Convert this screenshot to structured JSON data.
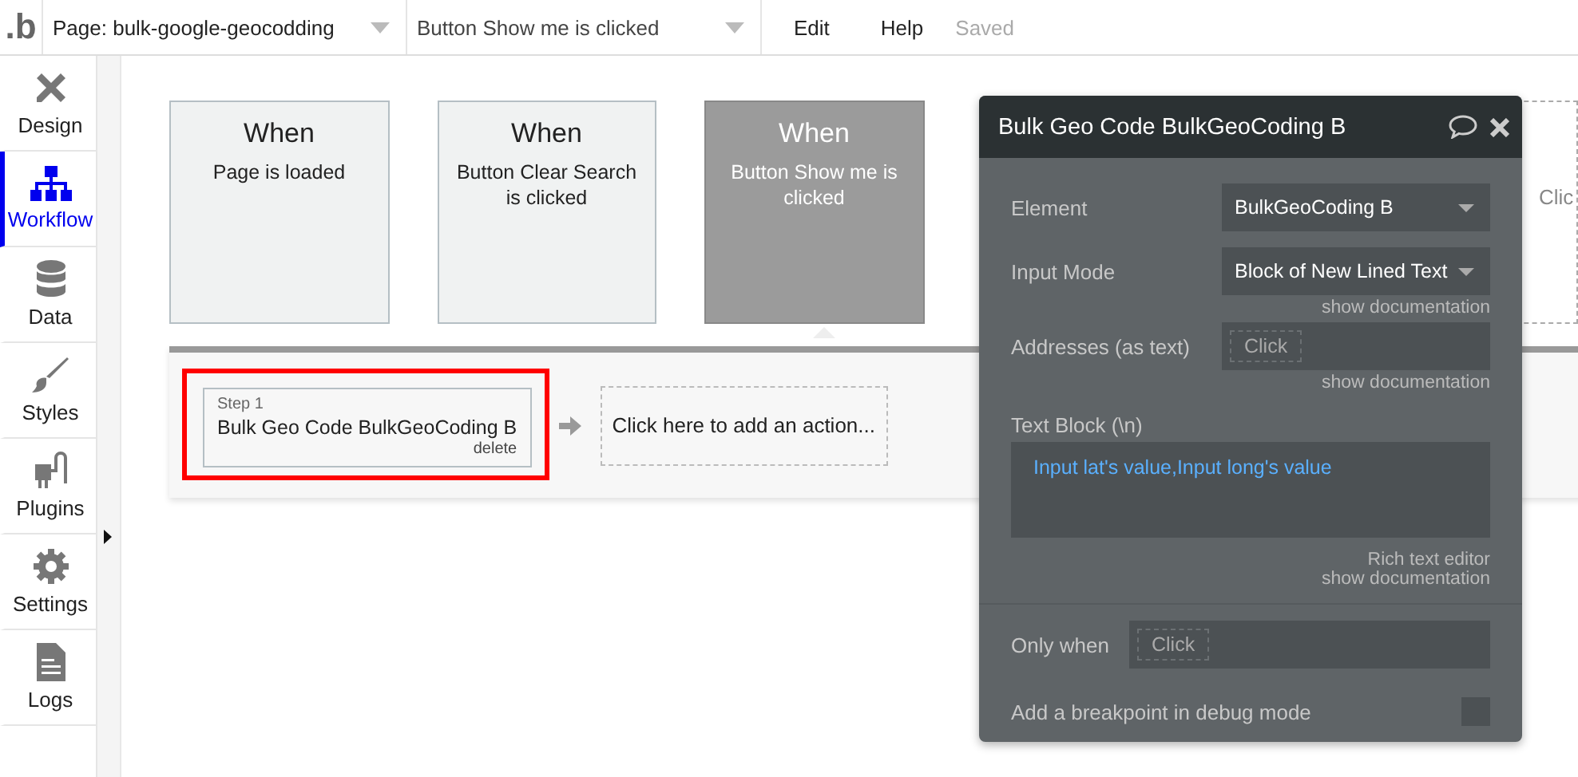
{
  "topbar": {
    "logo": ".b",
    "page_select": "Page: bulk-google-geocodding",
    "event_select": "Button Show me is clicked",
    "menu": [
      "Edit",
      "Help"
    ],
    "status": "Saved"
  },
  "sidebar": {
    "items": [
      {
        "label": "Design",
        "selected": false
      },
      {
        "label": "Workflow",
        "selected": true
      },
      {
        "label": "Data",
        "selected": false
      },
      {
        "label": "Styles",
        "selected": false
      },
      {
        "label": "Plugins",
        "selected": false
      },
      {
        "label": "Settings",
        "selected": false
      },
      {
        "label": "Logs",
        "selected": false
      }
    ]
  },
  "events": [
    {
      "kind": "event",
      "heading": "When",
      "text": "Page is loaded",
      "selected": false
    },
    {
      "kind": "event",
      "heading": "When",
      "text": "Button Clear Search is clicked",
      "selected": false
    },
    {
      "kind": "event",
      "heading": "When",
      "text": "Button Show me is clicked",
      "selected": true
    },
    {
      "kind": "add",
      "text": "Clic"
    }
  ],
  "actions": {
    "steps": [
      {
        "label": "Step 1",
        "title": "Bulk Geo Code BulkGeoCoding B",
        "delete": "delete",
        "selected": true
      }
    ],
    "add_action": "Click here to add an action..."
  },
  "panel": {
    "title": "Bulk Geo Code BulkGeoCoding B",
    "fields": [
      {
        "kind": "dropdown",
        "label": "Element",
        "value": "BulkGeoCoding B"
      },
      {
        "kind": "dropdown",
        "label": "Input Mode",
        "value": "Block of New Lined Text",
        "doc": "show documentation"
      },
      {
        "kind": "expression",
        "label": "Addresses (as text)",
        "chip": "Click",
        "doc": "show documentation"
      },
      {
        "kind": "textblock",
        "label": "Text Block (\\n)",
        "value": "Input lat's value,Input long's value",
        "editor": "Rich text editor",
        "doc": "show documentation"
      }
    ],
    "only_when": {
      "label": "Only when",
      "chip": "Click"
    },
    "breakpoint": {
      "label": "Add a breakpoint in debug mode",
      "checked": false
    }
  }
}
